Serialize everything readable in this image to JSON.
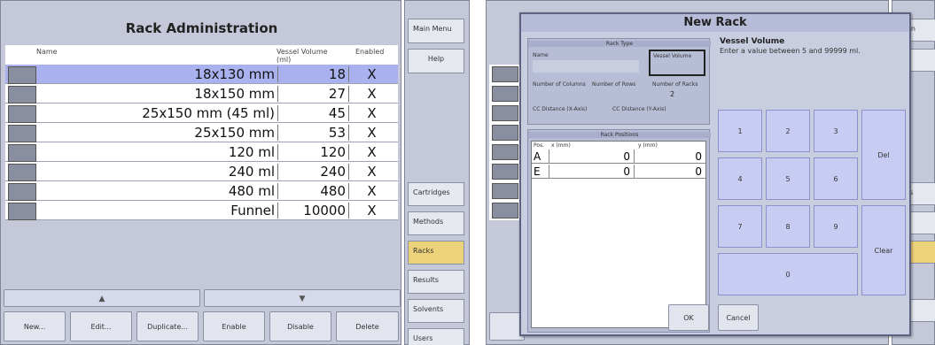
{
  "left": {
    "title": "Rack Administration",
    "columns": {
      "name": "Name",
      "vessel_volume": "Vessel Volume\n(ml)",
      "enabled": "Enabled"
    },
    "rows": [
      {
        "name": "18x130 mm",
        "volume": "18",
        "enabled": "X"
      },
      {
        "name": "18x150 mm",
        "volume": "27",
        "enabled": "X"
      },
      {
        "name": "25x150 mm (45 ml)",
        "volume": "45",
        "enabled": "X"
      },
      {
        "name": "25x150 mm",
        "volume": "53",
        "enabled": "X"
      },
      {
        "name": "120 ml",
        "volume": "120",
        "enabled": "X"
      },
      {
        "name": "240 ml",
        "volume": "240",
        "enabled": "X"
      },
      {
        "name": "480 ml",
        "volume": "480",
        "enabled": "X"
      },
      {
        "name": "Funnel",
        "volume": "10000",
        "enabled": "X"
      }
    ],
    "scroll": {
      "up": "▲",
      "down": "▼"
    },
    "buttons": [
      "New...",
      "Edit...",
      "Duplicate...",
      "Enable",
      "Disable",
      "Delete"
    ],
    "side_menu": {
      "top": [
        "Main Menu",
        "Help"
      ],
      "bottom": [
        "Cartridges",
        "Methods",
        "Racks",
        "Results",
        "Solvents",
        "Users"
      ],
      "active": "Racks"
    }
  },
  "right": {
    "dialog_title": "New Rack",
    "rack_type": {
      "section": "Rack Type",
      "name_label": "Name",
      "vessel_volume_label": "Vessel Volume",
      "num_columns_label": "Number of Columns",
      "num_rows_label": "Number of Rows",
      "num_racks_label": "Number of Racks",
      "num_racks_value": "2",
      "cc_x_label": "CC Distance (X-Axis)",
      "cc_y_label": "CC Distance (Y-Axis)"
    },
    "rack_positions": {
      "section": "Rack Positions",
      "columns": [
        "Pos.",
        "x (mm)",
        "y (mm)"
      ],
      "rows": [
        {
          "pos": "A",
          "x": "0",
          "y": "0"
        },
        {
          "pos": "E",
          "x": "0",
          "y": "0"
        }
      ]
    },
    "field": {
      "title": "Vessel Volume",
      "hint": "Enter a value between 5 and 99999 ml."
    },
    "keypad": {
      "keys": [
        "1",
        "2",
        "3",
        "4",
        "5",
        "6",
        "7",
        "8",
        "9"
      ],
      "zero": "0",
      "del": "Del",
      "clear": "Clear"
    },
    "ok": "OK",
    "cancel": "Cancel",
    "behind_side": [
      "Men",
      "lp",
      "ges",
      "ds",
      "ts"
    ]
  }
}
